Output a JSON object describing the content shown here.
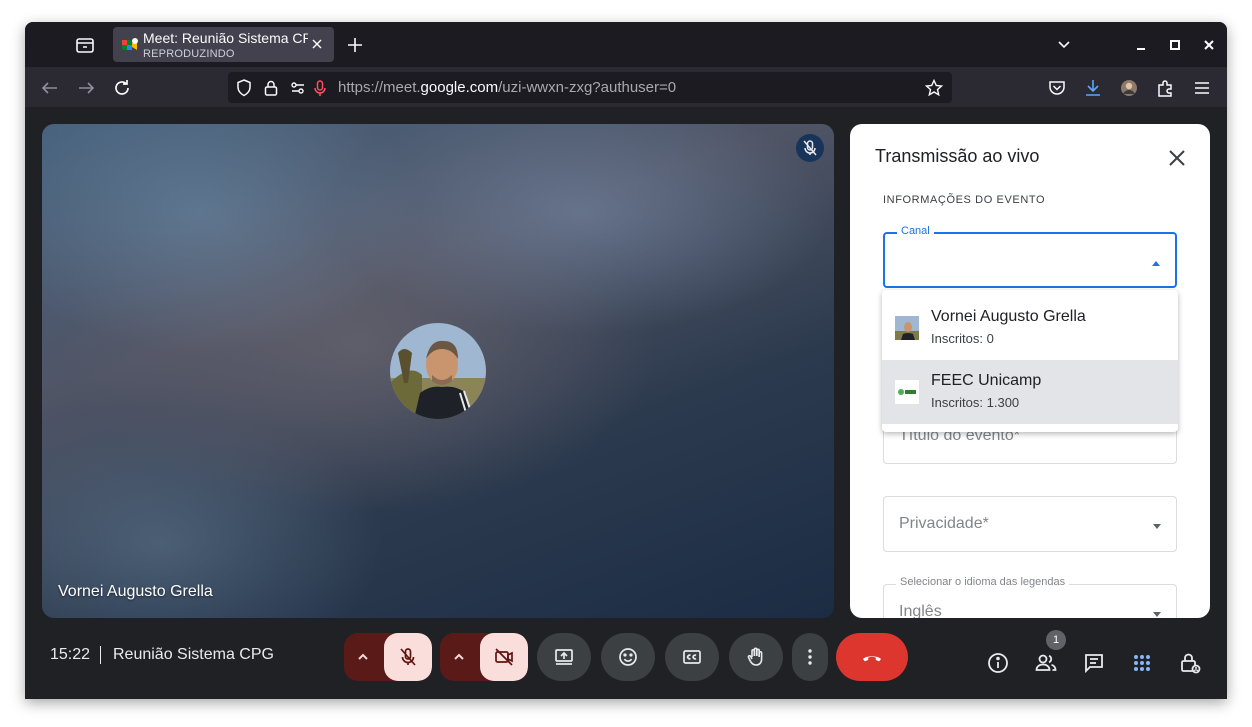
{
  "browser": {
    "tab": {
      "title": "Meet: Reunião Sistema CPG",
      "subtitle": "REPRODUZINDO"
    },
    "url": {
      "prefix": "https://meet.",
      "host": "google.com",
      "path": "/uzi-wwxn-zxg?authuser=0"
    }
  },
  "stage": {
    "participant_name": "Vornei Augusto Grella"
  },
  "panel": {
    "title": "Transmissão ao vivo",
    "section_title": "INFORMAÇÕES DO EVENTO",
    "channel_field": {
      "label": "Canal",
      "value": ""
    },
    "channel_options": [
      {
        "name": "Vornei Augusto Grella",
        "subscribers": "Inscritos: 0"
      },
      {
        "name": "FEEC Unicamp",
        "subscribers": "Inscritos: 1.300"
      }
    ],
    "event_title_field": {
      "placeholder": "Título do evento*"
    },
    "privacy_field": {
      "placeholder": "Privacidade*"
    },
    "caption_language_field": {
      "label": "Selecionar o idioma das legendas",
      "value": "Inglês"
    }
  },
  "bottombar": {
    "time": "15:22",
    "meeting_name": "Reunião Sistema CPG",
    "participants_count": "1"
  },
  "colors": {
    "hangup": "#dc362e",
    "focus_blue": "#1a73e8",
    "muted_pill": "#f9dedc"
  }
}
